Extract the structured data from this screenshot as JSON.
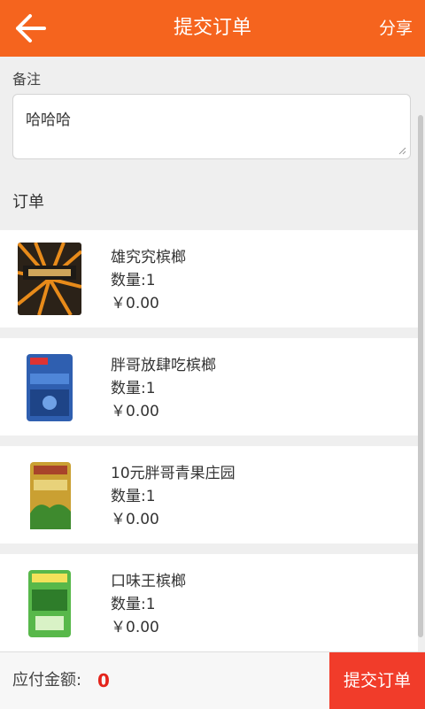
{
  "header": {
    "title": "提交订单",
    "share_label": "分享",
    "accent_color": "#f5641e"
  },
  "remark": {
    "label": "备注",
    "value": "哈哈哈"
  },
  "order": {
    "label": "订单",
    "items": [
      {
        "name": "雄究究槟榔",
        "qty": "数量:1",
        "price": "￥0.00"
      },
      {
        "name": "胖哥放肆吃槟榔",
        "qty": "数量:1",
        "price": "￥0.00"
      },
      {
        "name": "10元胖哥青果庄园",
        "qty": "数量:1",
        "price": "￥0.00"
      },
      {
        "name": "口味王槟榔",
        "qty": "数量:1",
        "price": "￥0.00"
      }
    ]
  },
  "footer": {
    "amount_label": "应付金额:",
    "amount_value": "0",
    "submit_label": "提交订单",
    "submit_color": "#f13c2a"
  }
}
